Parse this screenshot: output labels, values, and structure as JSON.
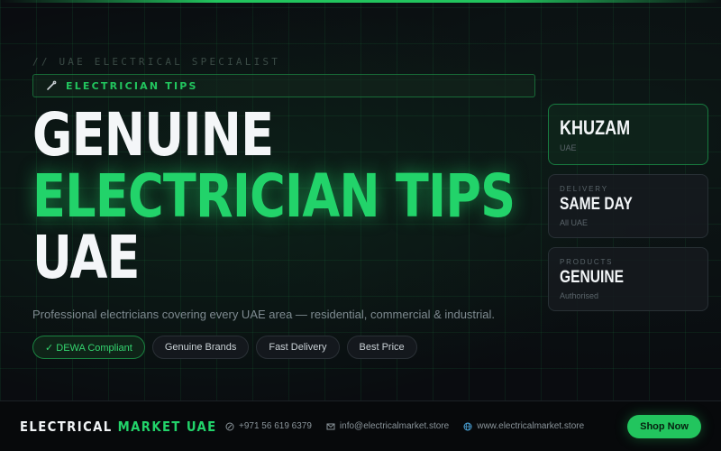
{
  "eyebrow": "// UAE ELECTRICAL SPECIALIST",
  "tag": {
    "icon": "wrench-icon",
    "label": "ELECTRICIAN TIPS"
  },
  "headline": {
    "line1": "GENUINE",
    "line2": "ELECTRICIAN TIPS",
    "line3": "UAE"
  },
  "subtitle": "Professional electricians covering every UAE area — residential, commercial & industrial.",
  "pills": [
    {
      "label": "✓ DEWA Compliant"
    },
    {
      "label": "Genuine Brands"
    },
    {
      "label": "Fast Delivery"
    },
    {
      "label": "Best Price"
    }
  ],
  "cards": [
    {
      "label": "",
      "value": "KHUZAM",
      "sub": "UAE"
    },
    {
      "label": "DELIVERY",
      "value": "SAME DAY",
      "sub": "All UAE"
    },
    {
      "label": "PRODUCTS",
      "value": "GENUINE",
      "sub": "Authorised"
    }
  ],
  "footer": {
    "brand_a": "ELECTRICAL ",
    "brand_b": "MARKET UAE",
    "phone": "+971 56 619 6379",
    "email": "info@electricalmarket.store",
    "website": "www.electricalmarket.store",
    "cta": "Shop Now"
  },
  "colors": {
    "accent": "#22c55e",
    "background": "#0a0c10"
  }
}
